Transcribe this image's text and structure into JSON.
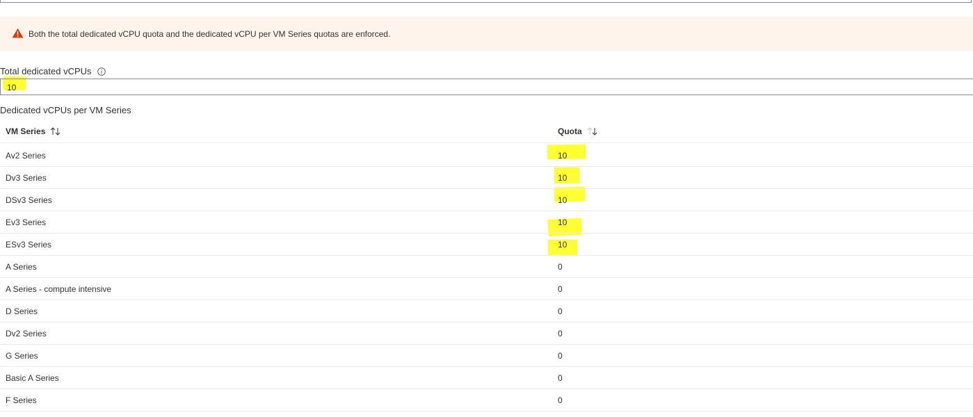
{
  "warning": {
    "text": "Both the total dedicated vCPU quota and the dedicated vCPU per VM Series quotas are enforced.",
    "icon": "warning-icon",
    "color": "#d83b01"
  },
  "total": {
    "label": "Total dedicated vCPUs",
    "value": "10",
    "info_icon": "info-icon"
  },
  "per_series": {
    "title": "Dedicated vCPUs per VM Series",
    "columns": [
      "VM Series",
      "Quota"
    ],
    "rows": [
      {
        "series": "Av2 Series",
        "quota": "10"
      },
      {
        "series": "Dv3 Series",
        "quota": "10"
      },
      {
        "series": "DSv3 Series",
        "quota": "10"
      },
      {
        "series": "Ev3 Series",
        "quota": "10"
      },
      {
        "series": "ESv3 Series",
        "quota": "10"
      },
      {
        "series": "A Series",
        "quota": "0"
      },
      {
        "series": "A Series - compute intensive",
        "quota": "0"
      },
      {
        "series": "D Series",
        "quota": "0"
      },
      {
        "series": "Dv2 Series",
        "quota": "0"
      },
      {
        "series": "G Series",
        "quota": "0"
      },
      {
        "series": "Basic A Series",
        "quota": "0"
      },
      {
        "series": "F Series",
        "quota": "0"
      }
    ]
  },
  "highlight_color": "#ffff33"
}
